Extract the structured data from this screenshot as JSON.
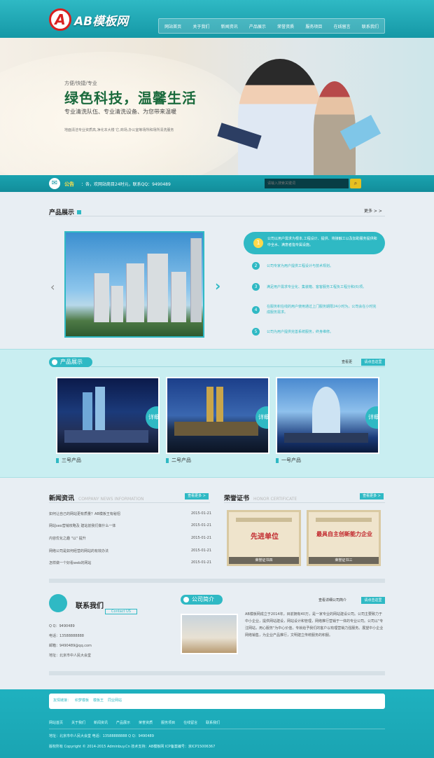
{
  "header": {
    "logo_mark": "A",
    "logo_text": "AB模板网",
    "nav": [
      "网站首页",
      "关于我们",
      "新闻资讯",
      "产品展示",
      "荣誉资质",
      "服务项目",
      "在线留言",
      "联系我们"
    ]
  },
  "banner": {
    "kicker": "方便/快捷/专业",
    "slogan": "绿色科技，温馨生活",
    "sub": "专业清洗队伍、专业清洗设备、为您带来温暖",
    "desc": "地面清洁专业资质高,净化本大楼 它,商场,办公室等场所和场所清洗服务"
  },
  "notice": {
    "label": "公告",
    "text": "：各，欢网站商目24时元，联系QQ：9490489",
    "search_placeholder": "请输入搜索关键词",
    "search_icon": "search-icon"
  },
  "products_intro": {
    "title": "产品展示",
    "more": "更多 > >",
    "features": [
      {
        "num": "1",
        "text": "公司以用户需求为根本,工程设计、提供、将接触工以及加助服务提供和中全水、满意者指专属设施。"
      },
      {
        "num": "2",
        "text": "公司专家为用户提供工程设计与技术规划。"
      },
      {
        "num": "3",
        "text": "满足用户需求专业化、集装箱、客客服务工程负工程分和(6)项。"
      },
      {
        "num": "4",
        "text": "在服务积在线的用户使用通过上门服务期限24小时为，公司会在小时完成服务需求。"
      },
      {
        "num": "5",
        "text": "公司为用户提供完善系统服务，终身维修。"
      }
    ]
  },
  "products_show": {
    "title": "产品展示",
    "more_text": "查看更",
    "more_link": "请点击这里",
    "detail_label": "详细",
    "items": [
      {
        "caption": "三号产品"
      },
      {
        "caption": "二号产品"
      },
      {
        "caption": "一号产品"
      }
    ]
  },
  "news": {
    "title": "新闻资讯",
    "title_en": "COMPANY NEWS INFORMATION",
    "more": "查看更多 >",
    "items": [
      {
        "text": "如何让自己的网站更有质量？AB模板王有秘招",
        "date": "2015-01-21"
      },
      {
        "text": "网站seo营销攻略及 建站前我们做什么一体",
        "date": "2015-01-21"
      },
      {
        "text": "内容优化之趣 \"以\" 提升",
        "date": "2015-01-21"
      },
      {
        "text": "网络公司是如何经营的网站的有效办法",
        "date": "2015-01-21"
      },
      {
        "text": "怎样做一个好看web的网站",
        "date": "2015-01-21"
      }
    ]
  },
  "honors": {
    "title": "荣誉证书",
    "title_en": "HONOR CERTIFICATE",
    "more": "查看更多 >",
    "items": [
      {
        "big_text": "先进单位",
        "caption": "荣誉证书四"
      },
      {
        "big_text": "最具自主创新能力企业",
        "caption": "荣誉证书三"
      }
    ]
  },
  "contact": {
    "title": "联系我们",
    "tag": "Contact US",
    "lines": [
      "Q Q：9490489",
      "电话：13588888888",
      "邮箱：9490489@qq.com",
      "地址：北京市中人民大会堂"
    ]
  },
  "about": {
    "title": "公司简介",
    "more_text": "查看详细公司简介",
    "more_link": "请点击这里",
    "text": "AB模板网成立于2014年，目前拥有40万，是一家专业的网站建设公司。公司主要致力于中小企业，提供网站建设，网站设计和管理，网络推行营销于一体的专业公司。公司以\"专注网站，用心服务\"为中心价值，专就给予我们的客户以有理营销力强服务。展望中小企业网络销售，为企业产品推行，文明建立传统服务的积服。"
  },
  "footer": {
    "links_label": "友情链接：",
    "links": [
      "织梦模板",
      "模板王",
      "同业网站"
    ],
    "nav": [
      "网站首页",
      "关于我们",
      "新闻资讯",
      "产品展示",
      "荣誉资质",
      "服务项目",
      "在线留言",
      "联系我们"
    ],
    "contact": "地址：北京市中人民大会堂    电话：13588888888    Q Q：9490489",
    "copyright": "版权所有 Copyright © 2014-2015 Adminbuy.Cn 技术支持：AB模板网 ICP备案编号：京ICP15006367"
  },
  "colors": {
    "accent": "#2fb9c4",
    "notice_label": "#ffe24a",
    "slogan": "#1a6a3c"
  }
}
